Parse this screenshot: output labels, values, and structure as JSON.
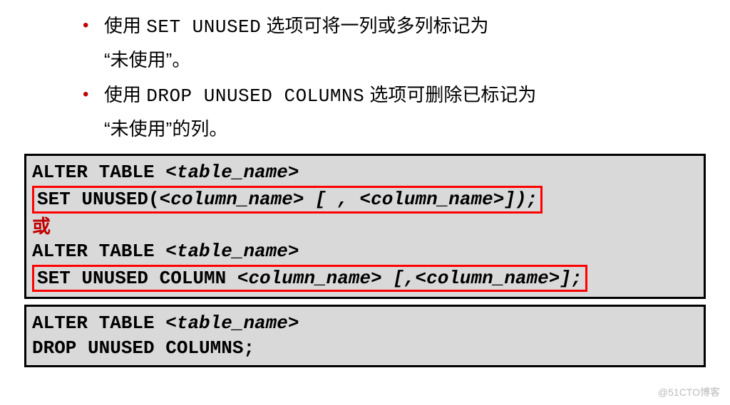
{
  "bullets": [
    {
      "pre": "使用 ",
      "code": "SET UNUSED",
      "post": " 选项可将一列或多列标记为",
      "cont": "“未使用”。"
    },
    {
      "pre": "使用 ",
      "code": "DROP UNUSED COLUMNS",
      "post": " 选项可删除已标记为",
      "cont": "“未使用”的列。"
    }
  ],
  "code1": {
    "line1a": "ALTER TABLE  <",
    "line1b": "table_name",
    "line1c": ">",
    "line2a": "SET   UNUSED(<",
    "line2b": "column_name",
    "line2c": "> [ , <",
    "line2d": "column_name",
    "line2e": ">]);",
    "or": "或",
    "line3a": "ALTER TABLE  <",
    "line3b": "table_name",
    "line3c": ">",
    "line4a": "SET   UNUSED COLUMN <",
    "line4b": "column_name",
    "line4c": "> [,<",
    "line4d": "column_name",
    "line4e": ">];"
  },
  "code2": {
    "line1a": "ALTER TABLE <",
    "line1b": "table_name",
    "line1c": ">",
    "line2": "DROP  UNUSED COLUMNS;"
  },
  "watermark": "@51CTO博客"
}
